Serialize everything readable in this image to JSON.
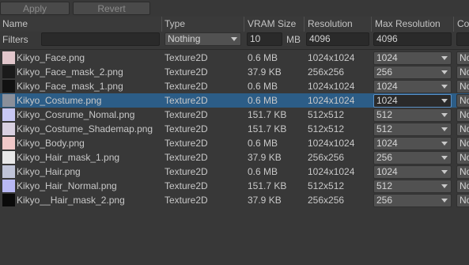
{
  "toolbar": {
    "apply_label": "Apply",
    "revert_label": "Revert"
  },
  "columns": [
    "Name",
    "Type",
    "VRAM Size",
    "Resolution",
    "Max Resolution",
    "Co"
  ],
  "filters": {
    "label": "Filters",
    "name_value": "",
    "type_value": "Nothing",
    "vram_value": "10",
    "vram_unit": "MB",
    "resolution_value": "4096",
    "max_resolution_value": "4096"
  },
  "rows": [
    {
      "name": "Kikyo_Face.png",
      "type": "Texture2D",
      "vram": "0.6 MB",
      "resolution": "1024x1024",
      "max_resolution": "1024",
      "compression": "No",
      "thumb": "#e2c7cc",
      "selected": false
    },
    {
      "name": "Kikyo_Face_mask_2.png",
      "type": "Texture2D",
      "vram": "37.9 KB",
      "resolution": "256x256",
      "max_resolution": "256",
      "compression": "No",
      "thumb": "#1a1a1a",
      "selected": false
    },
    {
      "name": "Kikyo_Face_mask_1.png",
      "type": "Texture2D",
      "vram": "0.6 MB",
      "resolution": "1024x1024",
      "max_resolution": "1024",
      "compression": "No",
      "thumb": "#111111",
      "selected": false
    },
    {
      "name": "Kikyo_Costume.png",
      "type": "Texture2D",
      "vram": "0.6 MB",
      "resolution": "1024x1024",
      "max_resolution": "1024",
      "compression": "No",
      "thumb": "#8a8f9a",
      "selected": true
    },
    {
      "name": "Kikyo_Cosrume_Nomal.png",
      "type": "Texture2D",
      "vram": "151.7 KB",
      "resolution": "512x512",
      "max_resolution": "512",
      "compression": "No",
      "thumb": "#c8c8f4",
      "selected": false
    },
    {
      "name": "Kikyo_Costume_Shademap.png",
      "type": "Texture2D",
      "vram": "151.7 KB",
      "resolution": "512x512",
      "max_resolution": "512",
      "compression": "No",
      "thumb": "#d8d0e0",
      "selected": false
    },
    {
      "name": "Kikyo_Body.png",
      "type": "Texture2D",
      "vram": "0.6 MB",
      "resolution": "1024x1024",
      "max_resolution": "1024",
      "compression": "No",
      "thumb": "#f0c8c8",
      "selected": false
    },
    {
      "name": "Kikyo_Hair_mask_1.png",
      "type": "Texture2D",
      "vram": "37.9 KB",
      "resolution": "256x256",
      "max_resolution": "256",
      "compression": "No",
      "thumb": "#e8e8e8",
      "selected": false
    },
    {
      "name": "Kikyo_Hair.png",
      "type": "Texture2D",
      "vram": "0.6 MB",
      "resolution": "1024x1024",
      "max_resolution": "1024",
      "compression": "No",
      "thumb": "#c0c4d8",
      "selected": false
    },
    {
      "name": "Kikyo_Hair_Normal.png",
      "type": "Texture2D",
      "vram": "151.7 KB",
      "resolution": "512x512",
      "max_resolution": "512",
      "compression": "No",
      "thumb": "#b8b8f4",
      "selected": false
    },
    {
      "name": "Kikyo__Hair_mask_2.png",
      "type": "Texture2D",
      "vram": "37.9 KB",
      "resolution": "256x256",
      "max_resolution": "256",
      "compression": "No",
      "thumb": "#0a0a0a",
      "selected": false
    }
  ]
}
